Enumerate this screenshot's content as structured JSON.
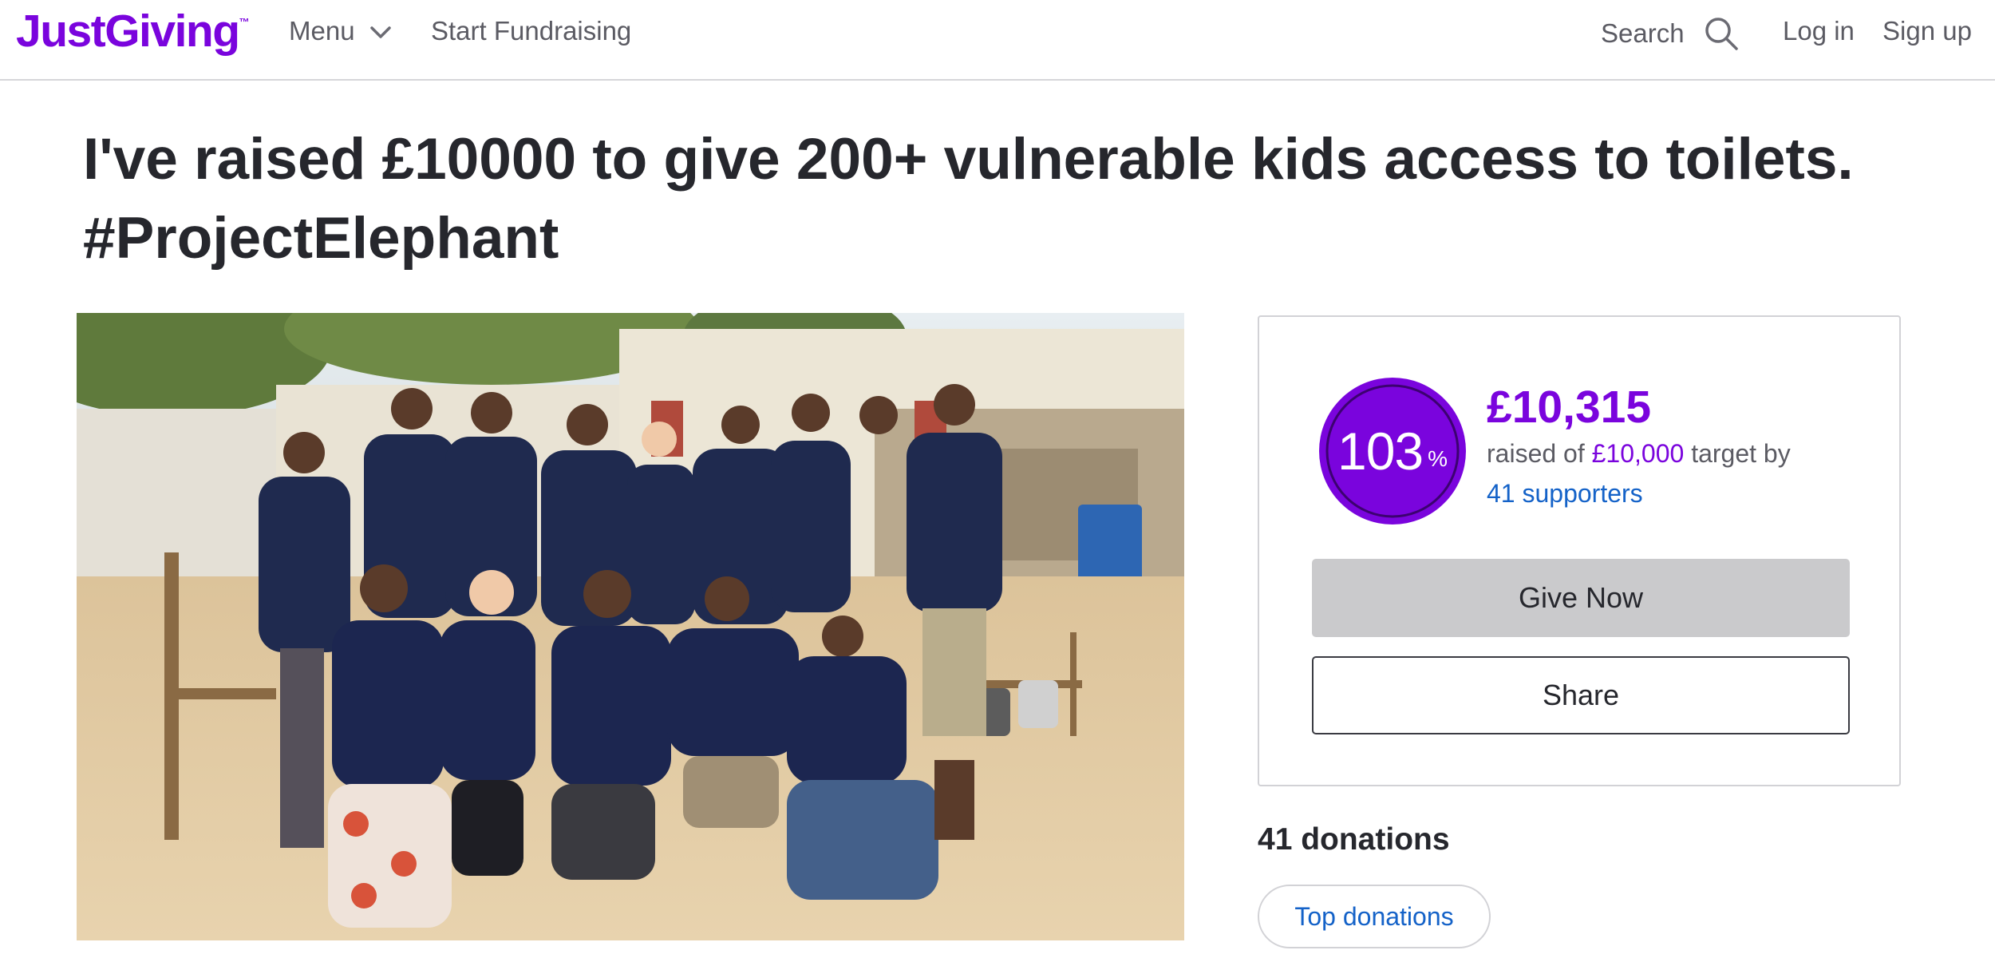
{
  "header": {
    "logo_text": "JustGiving",
    "logo_mark": "™",
    "menu_label": "Menu",
    "start_fundraising_label": "Start Fundraising",
    "search_label": "Search",
    "login_label": "Log in",
    "signup_label": "Sign up"
  },
  "page": {
    "title_line1": "I've raised £10000 to give 200+ vulnerable kids access to toilets.",
    "title_line2": "#ProjectElephant"
  },
  "progress": {
    "percent": "103",
    "percent_sign": "%",
    "amount_raised": "£10,315",
    "raised_of_prefix": "raised of",
    "target": "£10,000",
    "target_by_suffix": "target by",
    "supporters_link": "41 supporters",
    "give_now_label": "Give Now",
    "share_label": "Share"
  },
  "donations": {
    "heading": "41 donations",
    "top_donations_label": "Top donations"
  },
  "colors": {
    "brand": "#7a04dd",
    "link": "#1462c8",
    "button_disabled": "#cacacc"
  },
  "icons": {
    "menu": "chevron-down-icon",
    "search": "search-icon"
  }
}
